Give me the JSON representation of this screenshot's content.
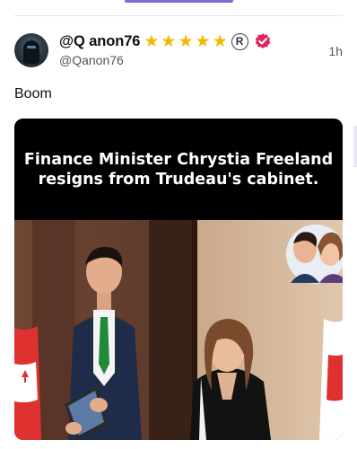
{
  "post": {
    "author": {
      "display_name": "@Q anon76",
      "handle": "@Qanon76",
      "stars": [
        "★",
        "★",
        "★",
        "★",
        "★"
      ],
      "registered_mark": "R"
    },
    "timestamp": "1h",
    "text": "Boom",
    "media": {
      "headline": "Finance Minister Chrystia Freeland resigns from Trudeau's cabinet."
    }
  },
  "colors": {
    "accent": "#7b6fd6",
    "star": "#f2b900",
    "verified": "#e0245e"
  }
}
